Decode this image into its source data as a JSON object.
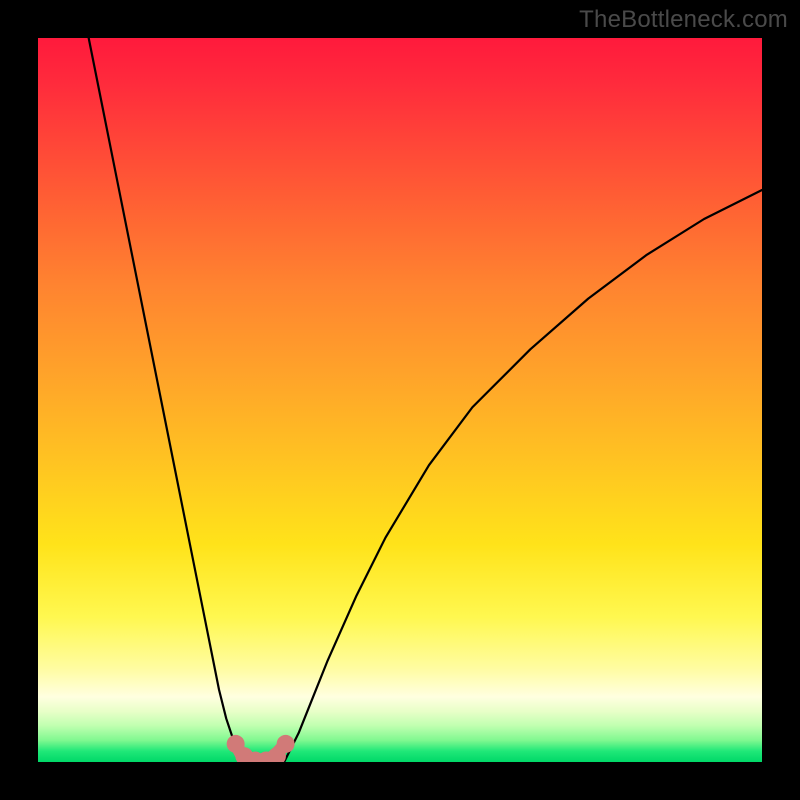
{
  "attribution": "TheBottleneck.com",
  "colors": {
    "frame": "#000000",
    "curve_stroke": "#000000",
    "marker_fill": "#d17a78",
    "marker_stroke": "#c86060",
    "u_stroke": "#d17a78"
  },
  "chart_data": {
    "type": "line",
    "title": "",
    "xlabel": "",
    "ylabel": "",
    "xlim": [
      0,
      100
    ],
    "ylim": [
      0,
      100
    ],
    "grid": false,
    "legend": false,
    "annotations": [
      "TheBottleneck.com"
    ],
    "series": [
      {
        "name": "left-branch",
        "x": [
          7,
          9,
          11,
          13,
          15,
          17,
          19,
          21,
          23,
          24,
          25,
          26,
          27,
          28,
          29
        ],
        "y": [
          100,
          90,
          80,
          70,
          60,
          50,
          40,
          30,
          20,
          15,
          10,
          6,
          3,
          1,
          0
        ]
      },
      {
        "name": "right-branch",
        "x": [
          34,
          36,
          38,
          40,
          44,
          48,
          54,
          60,
          68,
          76,
          84,
          92,
          100
        ],
        "y": [
          0,
          4,
          9,
          14,
          23,
          31,
          41,
          49,
          57,
          64,
          70,
          75,
          79
        ]
      }
    ],
    "markers": {
      "name": "trough-markers",
      "x": [
        27.3,
        28.5,
        30.0,
        31.5,
        33.0,
        34.2
      ],
      "y": [
        2.5,
        0.8,
        0.2,
        0.2,
        0.8,
        2.5
      ]
    },
    "u_curve": {
      "name": "trough-u",
      "x": [
        27.3,
        28.0,
        29.0,
        30.0,
        31.0,
        32.0,
        33.0,
        34.2
      ],
      "y": [
        2.5,
        1.2,
        0.4,
        0.15,
        0.15,
        0.4,
        1.2,
        2.5
      ]
    }
  }
}
